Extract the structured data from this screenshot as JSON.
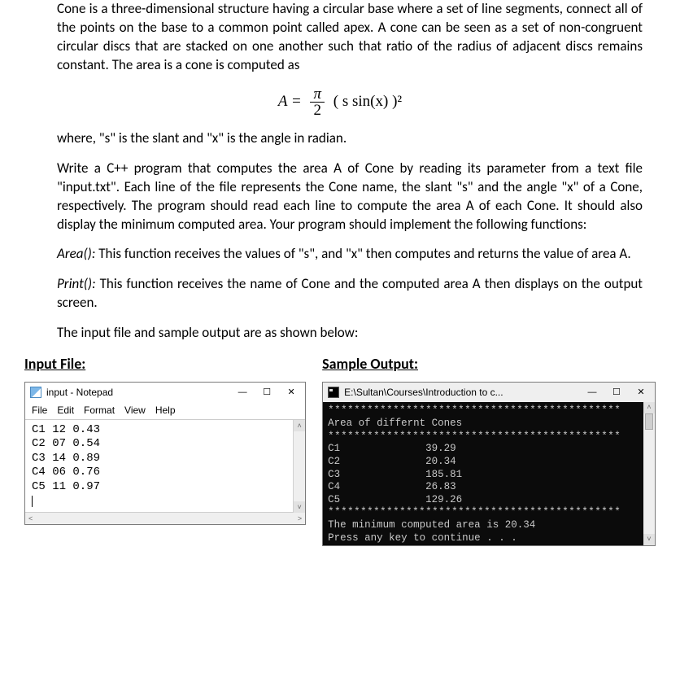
{
  "problem": {
    "p1": "Cone is a three-dimensional structure having a circular base where a set of line segments, connect all of the points on the base to a common point called apex. A cone can be seen as a set of non-congruent circular discs that are stacked on one another such that ratio of the radius of adjacent discs remains constant. The area is a cone is computed as",
    "formula_lhs": "A =",
    "formula_frac_num": "π",
    "formula_frac_den": "2",
    "formula_rhs": " ( s  sin(x) )²",
    "p2": "where, \"s\" is the slant and \"x\" is the angle in radian.",
    "p3": "Write a C++ program that computes the area A of Cone by reading its parameter from a text file \"input.txt\". Each line of the file represents the Cone name, the slant \"s\" and the angle \"x\" of a Cone, respectively. The program should read each line to compute the area A of each Cone. It should also display the minimum computed area. Your program should implement the following functions:",
    "fn1_name": "Area():",
    "fn1_body": "  This function receives the values of \"s\", and \"x\" then computes and returns the value of area A.",
    "fn2_name": "Print():",
    "fn2_body": " This function receives the name of Cone and the computed area A then displays on the output screen.",
    "p4": "The input file and sample output are as shown below:"
  },
  "headings": {
    "input": "Input File:",
    "output": "Sample Output:"
  },
  "notepad": {
    "title": "input - Notepad",
    "menu": [
      "File",
      "Edit",
      "Format",
      "View",
      "Help"
    ],
    "lines": [
      "C1 12 0.43",
      "C2 07 0.54",
      "C3 14 0.89",
      "C4 06 0.76",
      "C5 11 0.97"
    ]
  },
  "console": {
    "title": "E:\\Sultan\\Courses\\Introduction to c...",
    "stars_long": "*********************************************",
    "header": "Area of differnt Cones",
    "rows": [
      {
        "name": "C1",
        "area": "39.29"
      },
      {
        "name": "C2",
        "area": "20.34"
      },
      {
        "name": "C3",
        "area": "185.81"
      },
      {
        "name": "C4",
        "area": "26.83"
      },
      {
        "name": "C5",
        "area": "129.26"
      }
    ],
    "min_line": "The minimum computed area is 20.34",
    "press_line": "Press any key to continue . . ."
  },
  "glyphs": {
    "min": "—",
    "max": "☐",
    "close": "✕",
    "up": "˄",
    "down": "˅",
    "left": "<",
    "right": ">"
  }
}
